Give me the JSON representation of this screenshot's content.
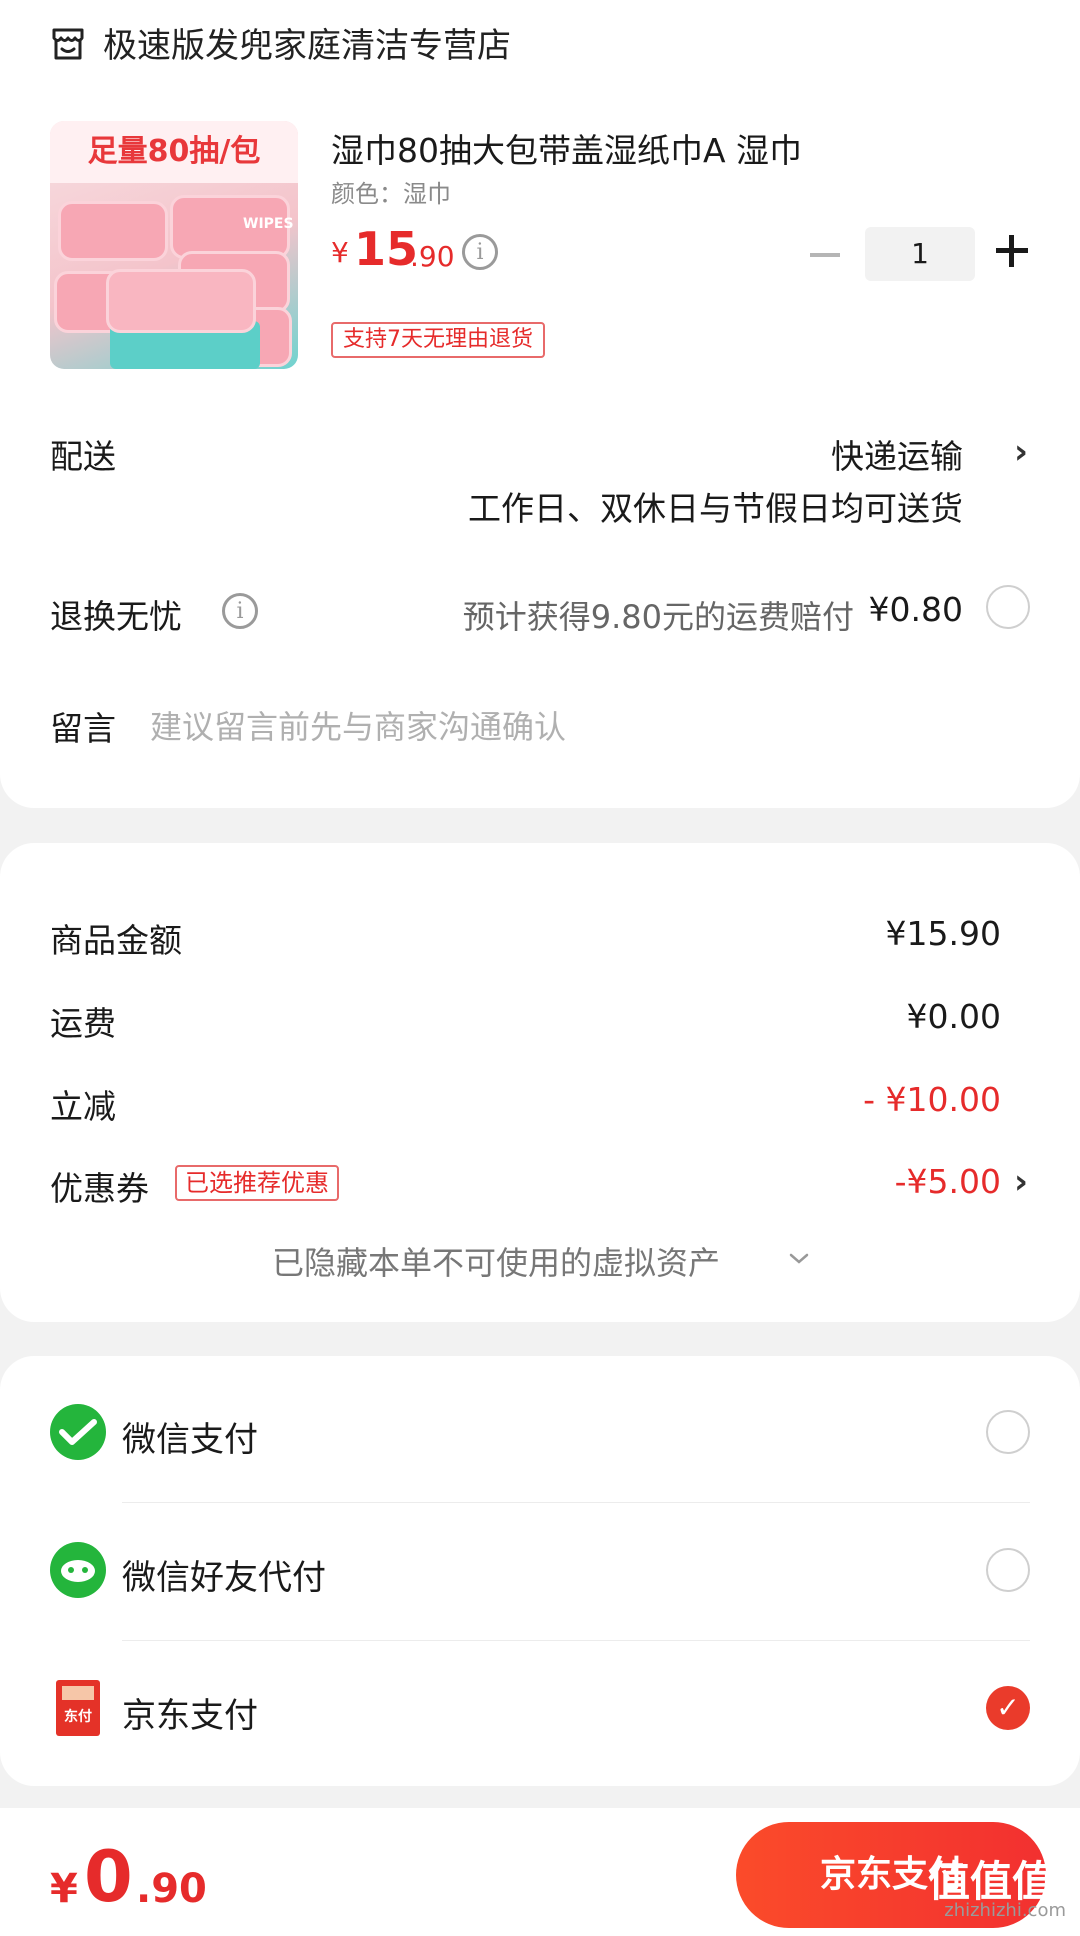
{
  "store": {
    "name": "极速版发兜家庭清洁专营店",
    "icon": "store-icon"
  },
  "product": {
    "title": "湿巾80抽大包带盖湿纸巾A 湿巾",
    "spec": "颜色：湿巾",
    "image_banner": "足量80抽/包",
    "image_pack_text": "WIPES",
    "price_symbol": "¥",
    "price_int": "15",
    "price_dec": ".90",
    "quantity": "1",
    "return_badge": "支持7天无理由退货"
  },
  "delivery": {
    "label": "配送",
    "method": "快递运输",
    "note": "工作日、双休日与节假日均可送货"
  },
  "return_insurance": {
    "label": "退换无忧",
    "desc": "预计获得9.80元的运费赔付",
    "price": "¥0.80"
  },
  "remark": {
    "label": "留言",
    "placeholder": "建议留言前先与商家沟通确认"
  },
  "summary": {
    "goods_label": "商品金额",
    "goods_value": "¥15.90",
    "shipping_label": "运费",
    "shipping_value": "¥0.00",
    "discount_label": "立减",
    "discount_value": "- ¥10.00",
    "coupon_label": "优惠券",
    "coupon_tag": "已选推荐优惠",
    "coupon_value": "-¥5.00",
    "hidden_assets": "已隐藏本单不可使用的虚拟资产"
  },
  "payment": {
    "options": [
      {
        "label": "微信支付",
        "selected": false
      },
      {
        "label": "微信好友代付",
        "selected": false
      },
      {
        "label": "京东支付",
        "selected": true
      }
    ],
    "jd_icon_text": "东付"
  },
  "bottom": {
    "total_symbol": "¥",
    "total_int": "0",
    "total_dec": ".90",
    "pay_button": "京东支付",
    "watermark": "zhizhizhi.com",
    "watermark_logo": "值值值"
  },
  "colors": {
    "accent": "#e62b2b",
    "wechat": "#24b53c",
    "jd": "#e43228"
  }
}
